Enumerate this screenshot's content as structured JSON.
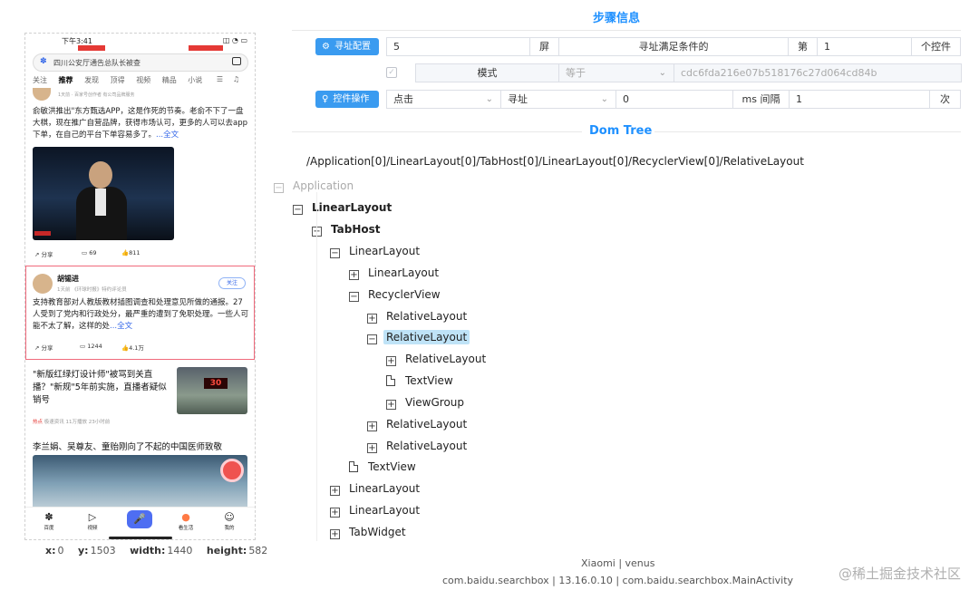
{
  "phone": {
    "status_time": "下午3:41",
    "search_text": "四川公安厅通告总队长被查",
    "tabs": [
      "关注",
      "推荐",
      "发现",
      "顶得",
      "视频",
      "精品",
      "小说"
    ],
    "card1_meta": "1天前 · 百家号创作者 有公司品牌服务",
    "card1_text": "俞敏洪推出\"东方甄选APP，这是作死的节奏。老俞不下了一盘大棋，现在推广自营品牌，获得市场认可，更多的人可以去app下单，在自己的平台下单容易多了。",
    "card1_more": "...全文",
    "card1_actions": {
      "share": "分享",
      "comments": "69",
      "likes": "811"
    },
    "card2_author": "胡锡进",
    "card2_meta": "1天前 《环球时报》特约评论员",
    "card2_follow": "关注",
    "card2_text": "支持教育部对人教版教材插图调查和处理意见所做的通报。27人受到了党内和行政处分，最严重的遭到了免职处理。一些人可能不太了解，这样的处",
    "card2_more": "...全文",
    "card2_actions": {
      "share": "分享",
      "comments": "1244",
      "likes": "4.1万"
    },
    "news3_title": "\"新版红绿灯设计师\"被骂到关直播？\"新规\"5年前实施，直播者疑似销号",
    "news3_meta_hot": "热点",
    "news3_meta": "极速资讯  11万播放  23小时前",
    "news3_led": "30",
    "news4_title": "李兰娟、吴尊友、童贻刚向了不起的中国医师致敬",
    "bottom_nav": [
      "百度",
      "视频",
      "",
      "看生活",
      "我的"
    ],
    "coords": {
      "x_label": "x:",
      "x": "0",
      "y_label": "y:",
      "y": "1503",
      "w_label": "width:",
      "w": "1440",
      "h_label": "height:",
      "h": "582"
    }
  },
  "steps": {
    "title": "步骤信息",
    "row1": {
      "button": "寻址配置",
      "count": "5",
      "unit": "屏",
      "condition": "寻址满足条件的",
      "ordinal_prefix": "第",
      "ordinal": "1",
      "suffix": "个控件"
    },
    "row2": {
      "mode": "模式",
      "operator": "等于",
      "value": "cdc6fda216e07b518176c27d064cd84b"
    },
    "row3": {
      "button": "控件操作",
      "action": "点击",
      "method": "寻址",
      "interval": "0",
      "interval_unit": "ms 间隔",
      "times": "1",
      "times_unit": "次"
    }
  },
  "dom_tree": {
    "title": "Dom Tree",
    "xpath": "/Application[0]/LinearLayout[0]/TabHost[0]/LinearLayout[0]/RecyclerView[0]/RelativeLayout",
    "nodes": [
      {
        "label": "Application",
        "toggle": "−"
      },
      {
        "label": "LinearLayout",
        "toggle": "−"
      },
      {
        "label": "TabHost",
        "toggle": "−"
      },
      {
        "label": "LinearLayout",
        "toggle": "−"
      },
      {
        "label": "LinearLayout",
        "toggle": "+"
      },
      {
        "label": "RecyclerView",
        "toggle": "−"
      },
      {
        "label": "RelativeLayout",
        "toggle": "+"
      },
      {
        "label": "RelativeLayout",
        "toggle": "−"
      },
      {
        "label": "RelativeLayout",
        "toggle": "+"
      },
      {
        "label": "TextView",
        "toggle": ""
      },
      {
        "label": "ViewGroup",
        "toggle": "+"
      },
      {
        "label": "RelativeLayout",
        "toggle": "+"
      },
      {
        "label": "RelativeLayout",
        "toggle": "+"
      },
      {
        "label": "TextView",
        "toggle": ""
      },
      {
        "label": "LinearLayout",
        "toggle": "+"
      },
      {
        "label": "LinearLayout",
        "toggle": "+"
      },
      {
        "label": "TabWidget",
        "toggle": "+"
      }
    ]
  },
  "footer": {
    "device": "Xiaomi | venus",
    "package": "com.baidu.searchbox | 13.16.0.10 | com.baidu.searchbox.MainActivity"
  },
  "watermark": "@稀土掘金技术社区",
  "colors": {
    "accent": "#1e90ff",
    "button": "#3a9bf0",
    "highlight_border": "#f06a7c",
    "selected_node": "#bfe3f7"
  }
}
